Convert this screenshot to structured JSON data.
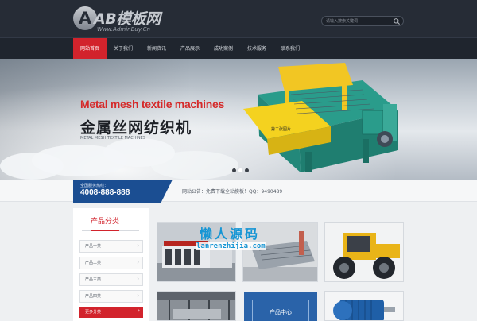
{
  "header": {
    "logo_mark": "A",
    "logo_text": "AB模板网",
    "logo_url": "Www.AdminBuy.Cn",
    "search_placeholder": "请输入搜索关键词"
  },
  "nav": {
    "items": [
      {
        "label": "网站首页",
        "active": true
      },
      {
        "label": "关于我们",
        "active": false
      },
      {
        "label": "新闻资讯",
        "active": false
      },
      {
        "label": "产品展示",
        "active": false
      },
      {
        "label": "成功案例",
        "active": false
      },
      {
        "label": "技术服务",
        "active": false
      },
      {
        "label": "联系我们",
        "active": false
      }
    ]
  },
  "banner": {
    "headline_en": "Metal mesh textile machines",
    "headline_cn": "金属丝网纺织机",
    "headline_sub": "METAL MESH TEXTILE MACHINES",
    "image_label": "第二张图片",
    "slide_count": 3,
    "active_slide": 2
  },
  "hotline": {
    "title": "全国服务热线：",
    "number": "4008-888-888"
  },
  "notice": {
    "text": "网站公告：免费下载全站模板！QQ：9490489"
  },
  "sidebar": {
    "title": "产品分类",
    "categories": [
      "产品一类",
      "产品二类",
      "产品三类",
      "产品四类"
    ],
    "more_label": "更多分类",
    "arrow": "›"
  },
  "products": {
    "watermark_cn": "懒人源码",
    "watermark_en": "lanrenzhijia.com",
    "center_label": "产品中心"
  },
  "colors": {
    "accent": "#d2232c",
    "header_bg": "#262c36",
    "nav_bg": "#1f252e",
    "hotline_bg": "#1b4e92",
    "watermark": "#1595d4"
  }
}
